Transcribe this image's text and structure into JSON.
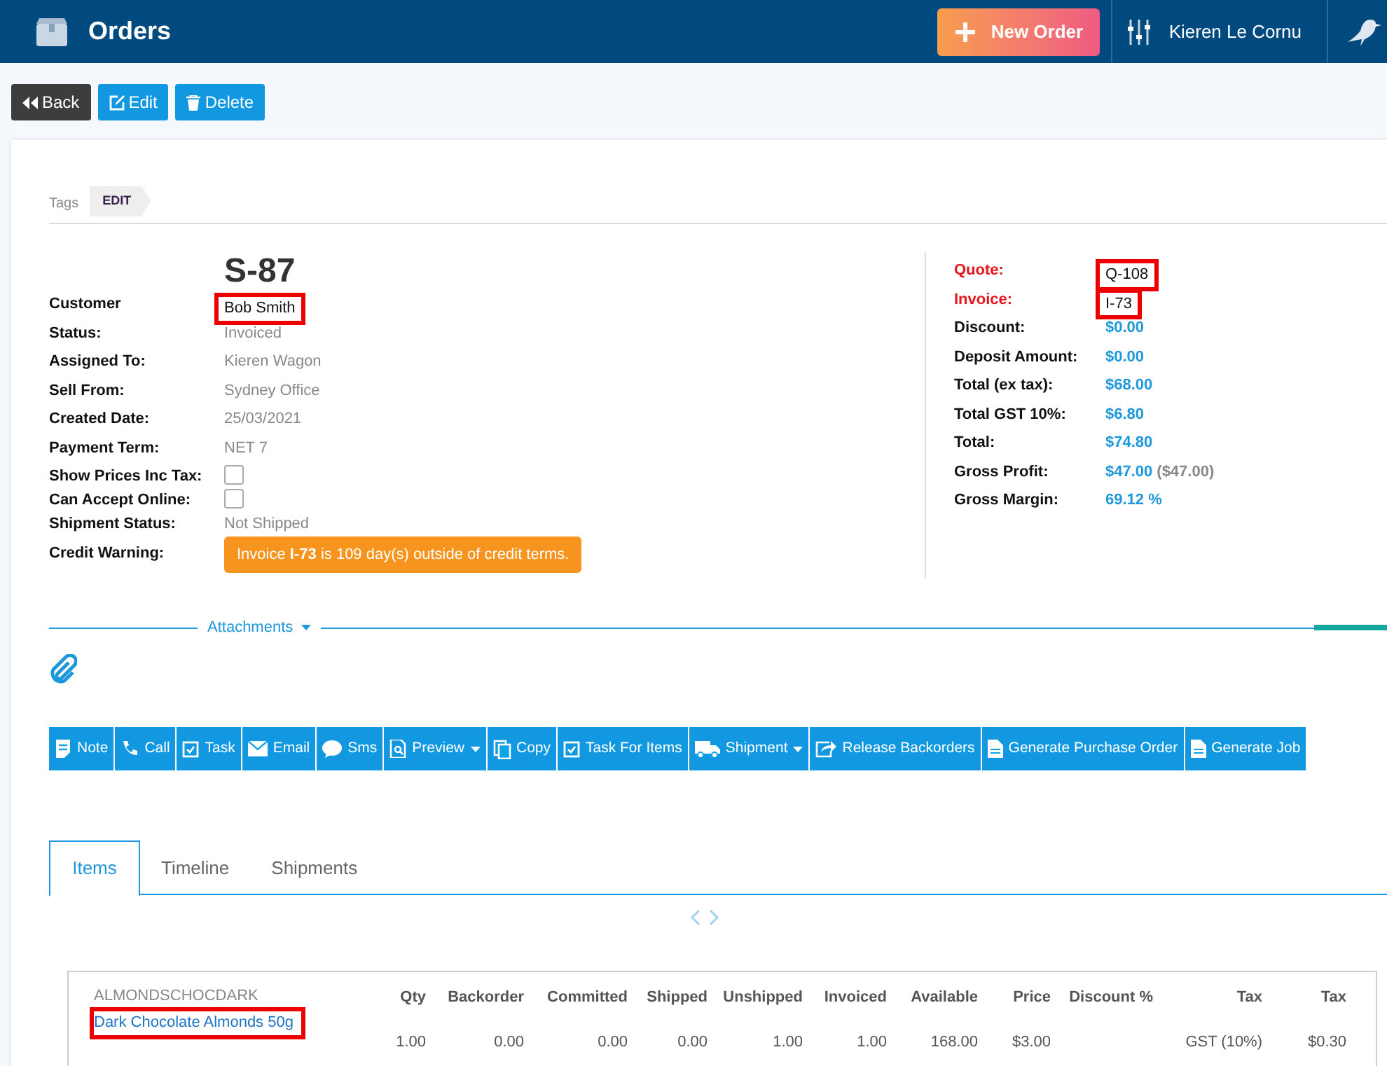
{
  "header": {
    "title": "Orders",
    "new_order": "New Order",
    "user": "Kieren Le Cornu"
  },
  "actions": [
    {
      "label": "Back",
      "kind": "back"
    },
    {
      "label": "Edit",
      "kind": "edit"
    },
    {
      "label": "Delete",
      "kind": "delete"
    }
  ],
  "tags": {
    "label": "Tags",
    "button": "EDIT"
  },
  "order": {
    "number": "S-87",
    "fields": [
      {
        "label": "Customer",
        "value": "Bob Smith",
        "kind": "text",
        "highlighted": true
      },
      {
        "label": "Status:",
        "value": "Invoiced",
        "kind": "text",
        "highlighted": false
      },
      {
        "label": "Assigned To:",
        "value": "Kieren Wagon",
        "kind": "text",
        "highlighted": false
      },
      {
        "label": "Sell From:",
        "value": "Sydney Office",
        "kind": "text",
        "highlighted": false
      },
      {
        "label": "Created Date:",
        "value": "25/03/2021",
        "kind": "text",
        "highlighted": false
      },
      {
        "label": "Payment Term:",
        "value": "NET 7",
        "kind": "text",
        "highlighted": false
      },
      {
        "label": "Show Prices Inc Tax:",
        "kind": "checkbox",
        "checked": false
      },
      {
        "label": "Can Accept Online:",
        "kind": "checkbox",
        "checked": false
      },
      {
        "label": "Shipment Status:",
        "value": "Not Shipped",
        "kind": "text",
        "highlighted": false
      },
      {
        "label": "Credit Warning:",
        "value": "Invoice **I-73** is 109 day(s) outside of credit terms.",
        "kind": "warning"
      }
    ]
  },
  "summary": [
    {
      "label": "Quote:",
      "value": "Q-108",
      "kind": "link",
      "highlighted": true
    },
    {
      "label": "Invoice:",
      "value": "I-73",
      "kind": "link",
      "highlighted": true
    },
    {
      "label": "Discount:",
      "value": "$0.00",
      "kind": "amount"
    },
    {
      "label": "Deposit Amount:",
      "value": "$0.00",
      "kind": "amount"
    },
    {
      "label": "Total (ex tax):",
      "value": "$68.00",
      "kind": "amount"
    },
    {
      "label": "Total GST 10%:",
      "value": "$6.80",
      "kind": "amount"
    },
    {
      "label": "Total:",
      "value": "$74.80",
      "kind": "amount"
    },
    {
      "label": "Gross Profit:",
      "value": "$47.00",
      "extra": "($47.00)",
      "kind": "amount"
    },
    {
      "label": "Gross Margin:",
      "value": "69.12 %",
      "kind": "amount"
    }
  ],
  "attachments": {
    "label": "Attachments"
  },
  "toolbar": [
    {
      "label": "Note",
      "kind": "note",
      "dropdown": false
    },
    {
      "label": "Call",
      "kind": "phone",
      "dropdown": false
    },
    {
      "label": "Task",
      "kind": "task",
      "dropdown": false
    },
    {
      "label": "Email",
      "kind": "mail",
      "dropdown": false
    },
    {
      "label": "Sms",
      "kind": "sms",
      "dropdown": false
    },
    {
      "label": "Preview",
      "kind": "preview",
      "dropdown": true
    },
    {
      "label": "Copy",
      "kind": "copy",
      "dropdown": false
    },
    {
      "label": "Task For Items",
      "kind": "task",
      "dropdown": false
    },
    {
      "label": "Shipment",
      "kind": "truck",
      "dropdown": true
    },
    {
      "label": "Release Backorders",
      "kind": "share",
      "dropdown": false
    },
    {
      "label": "Generate Purchase Order",
      "kind": "doc",
      "dropdown": false
    },
    {
      "label": "Generate Job",
      "kind": "doc",
      "dropdown": false
    }
  ],
  "tabs": [
    {
      "label": "Items",
      "selected": true
    },
    {
      "label": "Timeline",
      "selected": false
    },
    {
      "label": "Shipments",
      "selected": false
    }
  ],
  "items": {
    "columns": [
      "Qty",
      "Backorder",
      "Committed",
      "Shipped",
      "Unshipped",
      "Invoiced",
      "Available",
      "Price",
      "Discount %",
      "Tax",
      "Tax"
    ],
    "rows": [
      {
        "code": "ALMONDSCHOCDARK",
        "name": "Dark Chocolate Almonds 50g",
        "highlighted": true,
        "cells": [
          "1.00",
          "0.00",
          "0.00",
          "0.00",
          "1.00",
          "1.00",
          "168.00",
          "$3.00",
          "",
          "GST (10%)",
          "$0.30"
        ]
      }
    ]
  }
}
